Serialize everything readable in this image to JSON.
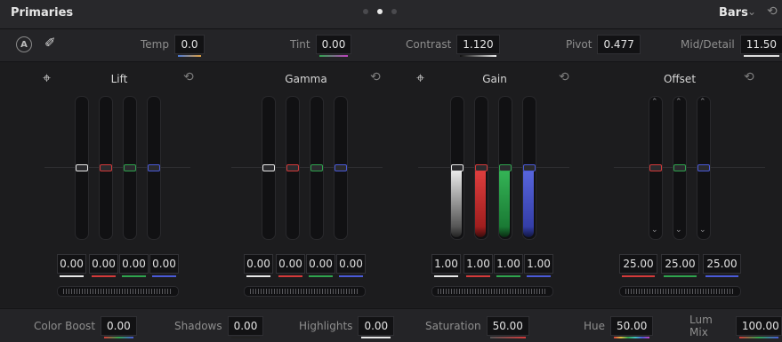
{
  "header": {
    "title": "Primaries",
    "mode": "Bars"
  },
  "toolbar": {
    "temp": {
      "label": "Temp",
      "value": "0.0"
    },
    "tint": {
      "label": "Tint",
      "value": "0.00"
    },
    "contrast": {
      "label": "Contrast",
      "value": "1.120"
    },
    "pivot": {
      "label": "Pivot",
      "value": "0.477"
    },
    "middetail": {
      "label": "Mid/Detail",
      "value": "11.50"
    }
  },
  "wheels": {
    "lift": {
      "title": "Lift",
      "values": [
        "0.00",
        "0.00",
        "0.00",
        "0.00"
      ]
    },
    "gamma": {
      "title": "Gamma",
      "values": [
        "0.00",
        "0.00",
        "0.00",
        "0.00"
      ]
    },
    "gain": {
      "title": "Gain",
      "values": [
        "1.00",
        "1.00",
        "1.00",
        "1.00"
      ]
    },
    "offset": {
      "title": "Offset",
      "values": [
        "25.00",
        "25.00",
        "25.00"
      ]
    }
  },
  "bottom": {
    "colorboost": {
      "label": "Color Boost",
      "value": "0.00"
    },
    "shadows": {
      "label": "Shadows",
      "value": "0.00"
    },
    "highlights": {
      "label": "Highlights",
      "value": "0.00"
    },
    "saturation": {
      "label": "Saturation",
      "value": "50.00"
    },
    "hue": {
      "label": "Hue",
      "value": "50.00"
    },
    "lummix": {
      "label": "Lum Mix",
      "value": "100.00"
    }
  },
  "channel_colors": {
    "y": "#e8e8e8",
    "r": "#d43a3a",
    "g": "#2fa44e",
    "b": "#4a5ad8"
  },
  "icons": {
    "auto": "A",
    "picker": "color-picker-icon",
    "reset": "reset-icon",
    "crosshair": "crosshair-icon",
    "chevron": "chevron-down-icon"
  }
}
